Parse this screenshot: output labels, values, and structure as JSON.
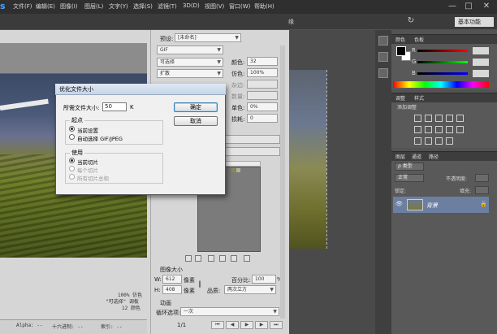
{
  "menubar": {
    "logo": "s",
    "items": [
      "文件(F)",
      "编辑(E)",
      "图像(I)",
      "图层(L)",
      "文字(Y)",
      "选择(S)",
      "滤镜(T)",
      "3D(D)",
      "视图(V)",
      "窗口(W)",
      "帮助(H)"
    ],
    "window_buttons": [
      "—",
      "□",
      "✕"
    ]
  },
  "optionsbar": {
    "suffix_text": "缘",
    "workspace": "基本功能"
  },
  "save_for_web": {
    "preset_label": "预设:",
    "preset_value": "[未命名]",
    "format_value": "GIF",
    "reduction_value": "可选择",
    "dither_value": "扩散",
    "colors_label": "颜色:",
    "colors_value": "32",
    "dither_label": "仿色:",
    "dither_amount": "100%",
    "transparency_label": "杂边:",
    "amount_label": "数量:",
    "web_snap_label": "单色:",
    "web_snap_value": "0%",
    "lossy_label": "损耗:",
    "lossy_value": "0",
    "image_size_title": "图像大小",
    "w_label": "W:",
    "w_value": "612",
    "w_unit": "像素",
    "h_label": "H:",
    "h_value": "408",
    "h_unit": "像素",
    "percent_label": "百分比:",
    "percent_value": "100",
    "percent_unit": "%",
    "quality_label": "品质:",
    "quality_value": "两次立方",
    "animation_title": "动画",
    "loop_label": "循环选项:",
    "loop_value": "一次",
    "frame_counter": "1/1",
    "preview_info": [
      "100% 仿色",
      "\"可选择\" 调板",
      "12 颜色"
    ],
    "bottom_status": [
      "Alpha: --",
      "十六进制: --",
      "索引: --"
    ]
  },
  "optimize_dialog": {
    "title": "优化文件大小",
    "file_size_label": "所需文件大小:",
    "file_size_value": "50",
    "file_size_unit": "K",
    "ok_label": "确定",
    "cancel_label": "取消",
    "start_group_title": "起点",
    "start_options": [
      {
        "label": "当前设置",
        "selected": true,
        "enabled": true
      },
      {
        "label": "自动选择 GIF/JPEG",
        "selected": false,
        "enabled": true
      }
    ],
    "use_group_title": "使用",
    "use_options": [
      {
        "label": "当前切片",
        "selected": true,
        "enabled": true
      },
      {
        "label": "每个切片",
        "selected": false,
        "enabled": false
      },
      {
        "label": "所有切片总和",
        "selected": false,
        "enabled": false
      }
    ]
  },
  "color_panel": {
    "tabs": [
      "颜色",
      "色板"
    ],
    "r_label": "R",
    "g_label": "G",
    "b_label": "B"
  },
  "adjust_panel": {
    "tabs": [
      "调整",
      "样式"
    ],
    "add_label": "添加调整"
  },
  "layers_panel": {
    "tabs": [
      "图层",
      "通道",
      "路径"
    ],
    "kind_filter": "ρ 类型",
    "blend_mode": "正常",
    "opacity_label": "不透明度:",
    "lock_label": "锁定:",
    "fill_label": "填充:",
    "layer_name": "背景"
  },
  "colors": {
    "menubar_bg": "#2f2f2f",
    "panel_bg": "#535353",
    "dialog_bg": "#f0f0f0",
    "selected_layer": "#6d7fa0"
  }
}
